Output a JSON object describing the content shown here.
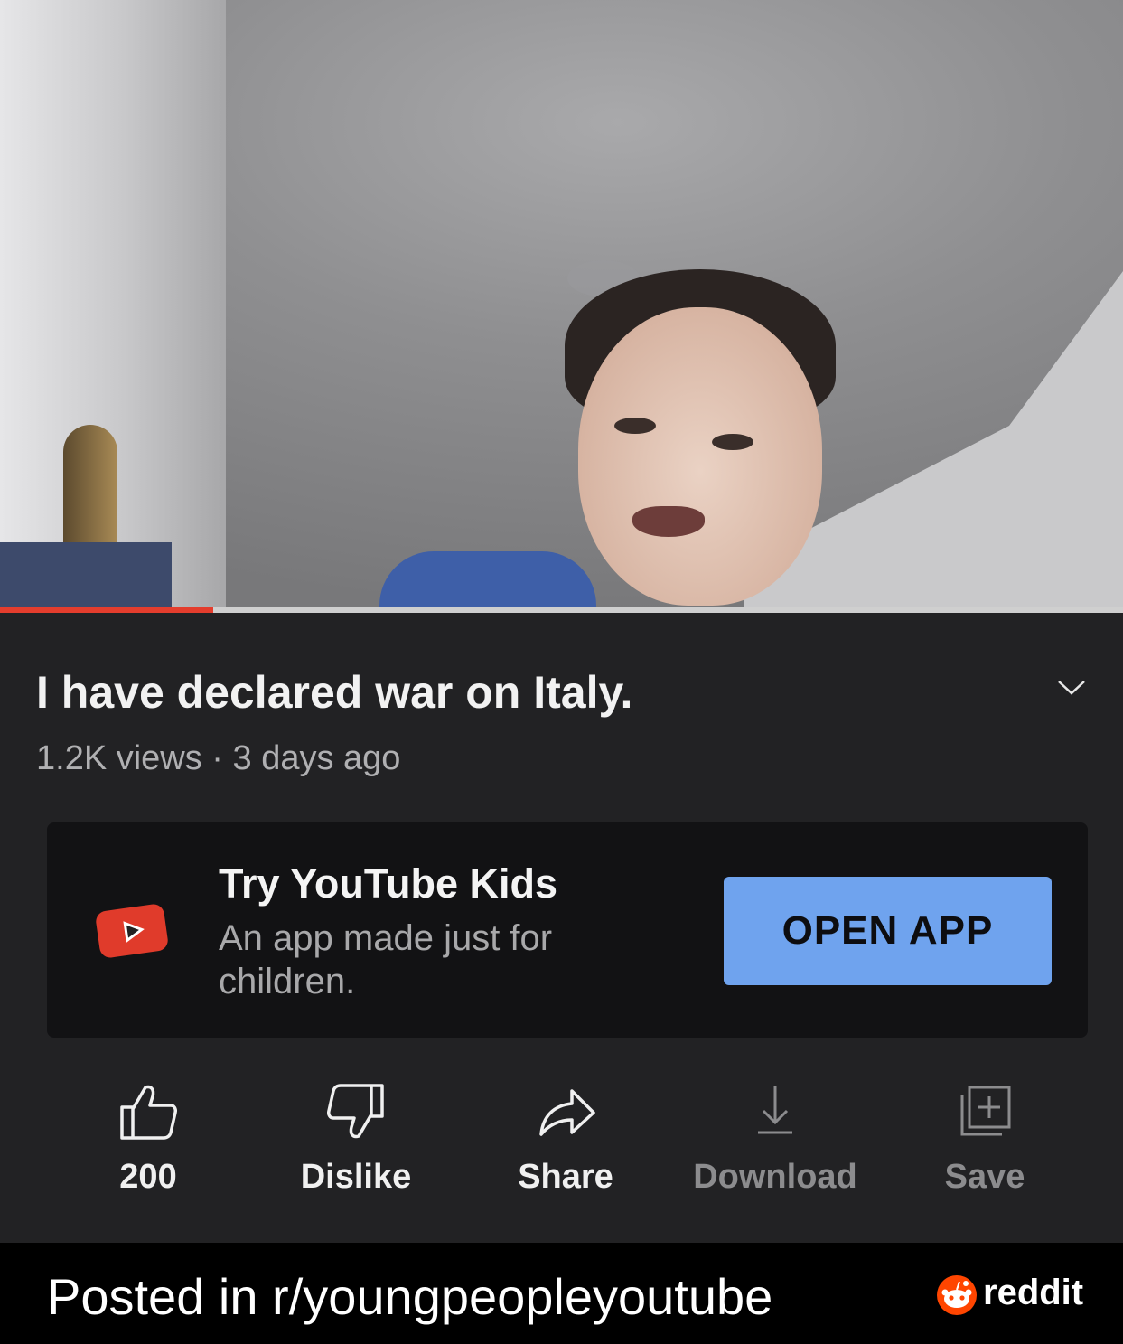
{
  "video": {
    "progress_fraction": 0.19,
    "progress_color": "#e43d2d"
  },
  "details": {
    "title": "I have declared war on Italy.",
    "meta": "1.2K views · 3 days ago",
    "expand_icon": "chevron-down-icon"
  },
  "promo": {
    "title": "Try YouTube Kids",
    "subtitle": "An app made just for children.",
    "button_label": "OPEN APP",
    "logo_icon": "youtube-kids-logo-icon",
    "button_color": "#6fa3ee"
  },
  "actions": [
    {
      "label": "200",
      "icon": "thumbs-up-icon"
    },
    {
      "label": "Dislike",
      "icon": "thumbs-down-icon"
    },
    {
      "label": "Share",
      "icon": "share-arrow-icon"
    },
    {
      "label": "Download",
      "icon": "download-icon"
    },
    {
      "label": "Save",
      "icon": "save-to-playlist-icon"
    }
  ],
  "footer": {
    "posted_text": "Posted in r/youngpeopleyoutube",
    "brand": "reddit",
    "brand_icon": "reddit-snoo-icon",
    "brand_color": "#ff4500"
  }
}
